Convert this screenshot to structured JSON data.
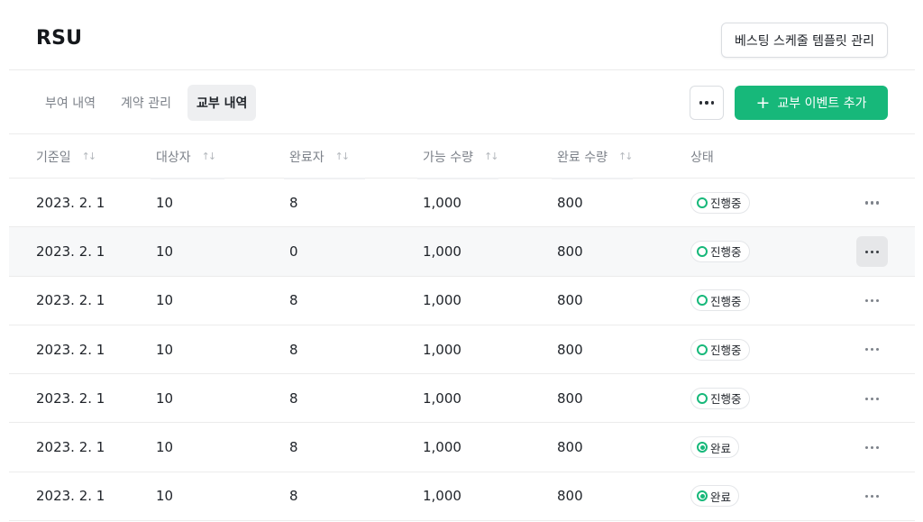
{
  "header": {
    "title": "RSU",
    "template_button": "베스팅 스케줄 템플릿 관리"
  },
  "tabs": [
    {
      "label": "부여 내역",
      "active": false
    },
    {
      "label": "계약 관리",
      "active": false
    },
    {
      "label": "교부 내역",
      "active": true
    }
  ],
  "toolbar": {
    "more_icon": "more-horizontal-icon",
    "add_button": "교부 이벤트 추가",
    "add_icon": "plus-icon",
    "accent_color": "#17b87a"
  },
  "table": {
    "columns": [
      "기준일",
      "대상자",
      "완료자",
      "가능 수량",
      "완료 수량",
      "상태"
    ],
    "sort_icon": "sort-arrows-icon",
    "rows": [
      {
        "date": "2023. 2. 1",
        "target": "10",
        "completed": "8",
        "available": "1,000",
        "completed_qty": "800",
        "status": "진행중",
        "status_type": "in-progress"
      },
      {
        "date": "2023. 2. 1",
        "target": "10",
        "completed": "0",
        "available": "1,000",
        "completed_qty": "800",
        "status": "진행중",
        "status_type": "in-progress"
      },
      {
        "date": "2023. 2. 1",
        "target": "10",
        "completed": "8",
        "available": "1,000",
        "completed_qty": "800",
        "status": "진행중",
        "status_type": "in-progress"
      },
      {
        "date": "2023. 2. 1",
        "target": "10",
        "completed": "8",
        "available": "1,000",
        "completed_qty": "800",
        "status": "진행중",
        "status_type": "in-progress"
      },
      {
        "date": "2023. 2. 1",
        "target": "10",
        "completed": "8",
        "available": "1,000",
        "completed_qty": "800",
        "status": "진행중",
        "status_type": "in-progress"
      },
      {
        "date": "2023. 2. 1",
        "target": "10",
        "completed": "8",
        "available": "1,000",
        "completed_qty": "800",
        "status": "완료",
        "status_type": "done"
      },
      {
        "date": "2023. 2. 1",
        "target": "10",
        "completed": "8",
        "available": "1,000",
        "completed_qty": "800",
        "status": "완료",
        "status_type": "done"
      }
    ],
    "hovered_row": 1
  }
}
